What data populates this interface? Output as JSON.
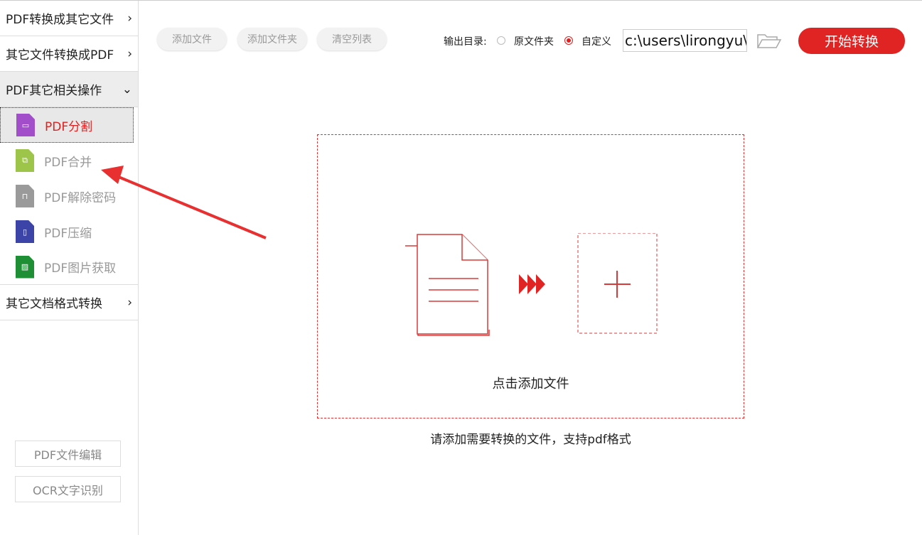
{
  "sidebar": {
    "categories": [
      "PDF转换成其它文件",
      "其它文件转换成PDF",
      "PDF其它相关操作",
      "其它文档格式转换"
    ],
    "items": [
      {
        "label": "PDF分割",
        "color": "#a24dc9"
      },
      {
        "label": "PDF合并",
        "color": "#9dc54a"
      },
      {
        "label": "PDF解除密码",
        "color": "#9a9a9a"
      },
      {
        "label": "PDF压缩",
        "color": "#3d44a8"
      },
      {
        "label": "PDF图片获取",
        "color": "#1f8f35"
      }
    ],
    "bottom_buttons": [
      "PDF文件编辑",
      "OCR文字识别"
    ]
  },
  "toolbar": {
    "add_file": "添加文件",
    "add_folder": "添加文件夹",
    "clear_list": "清空列表"
  },
  "output": {
    "label": "输出目录:",
    "option_original": "原文件夹",
    "option_custom": "自定义",
    "selected": "自定义",
    "path": "c:\\users\\lirongyu\\"
  },
  "start_button": "开始转换",
  "dropzone": {
    "caption": "点击添加文件",
    "hint": "请添加需要转换的文件，支持pdf格式"
  },
  "colors": {
    "accent": "#e02424"
  }
}
